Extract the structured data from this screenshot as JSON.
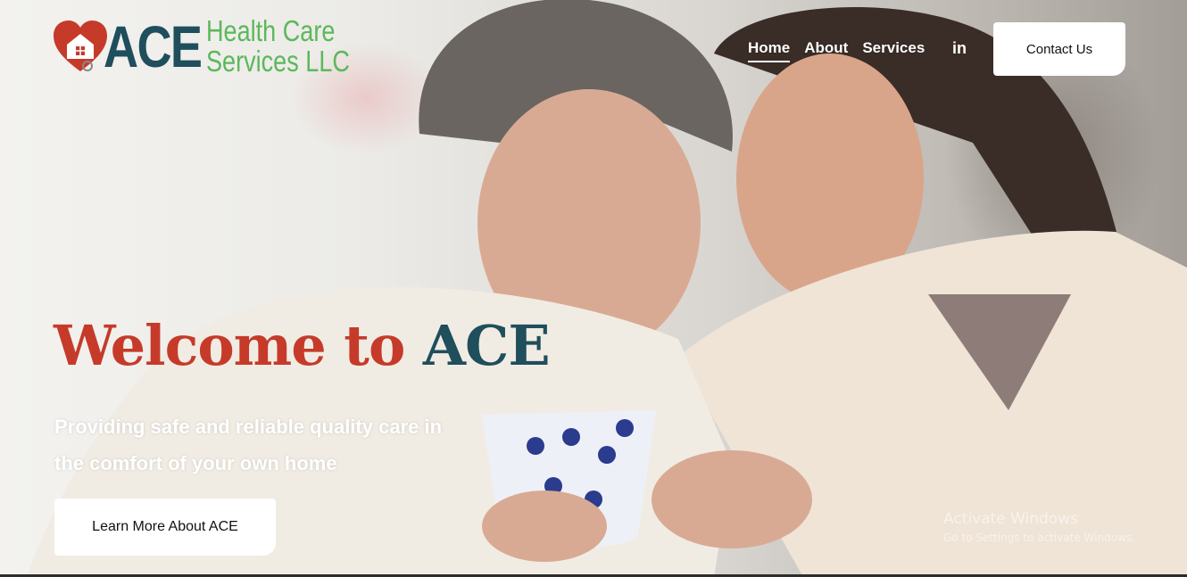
{
  "brand": {
    "logo_mark": "ACE",
    "name_line1": "Health Care",
    "name_line2": "Services LLC",
    "colors": {
      "red": "#c63a2a",
      "teal": "#1f4e5c",
      "green": "#5cb85c"
    }
  },
  "nav": {
    "items": [
      {
        "label": "Home",
        "active": true
      },
      {
        "label": "About",
        "active": false
      },
      {
        "label": "Services",
        "active": false
      }
    ],
    "linkedin_label": "in",
    "contact_label": "Contact Us"
  },
  "hero": {
    "title_part1": "Welcome to",
    "title_part2": "ACE",
    "tagline_line1": "Providing safe and reliable quality care in",
    "tagline_line2": "the comfort of your own home",
    "cta_label": "Learn More About ACE",
    "image_icon": "elderly-woman-and-caregiver-photo"
  },
  "watermark": {
    "title": "Activate Windows",
    "subtitle": "Go to Settings to activate Windows."
  }
}
